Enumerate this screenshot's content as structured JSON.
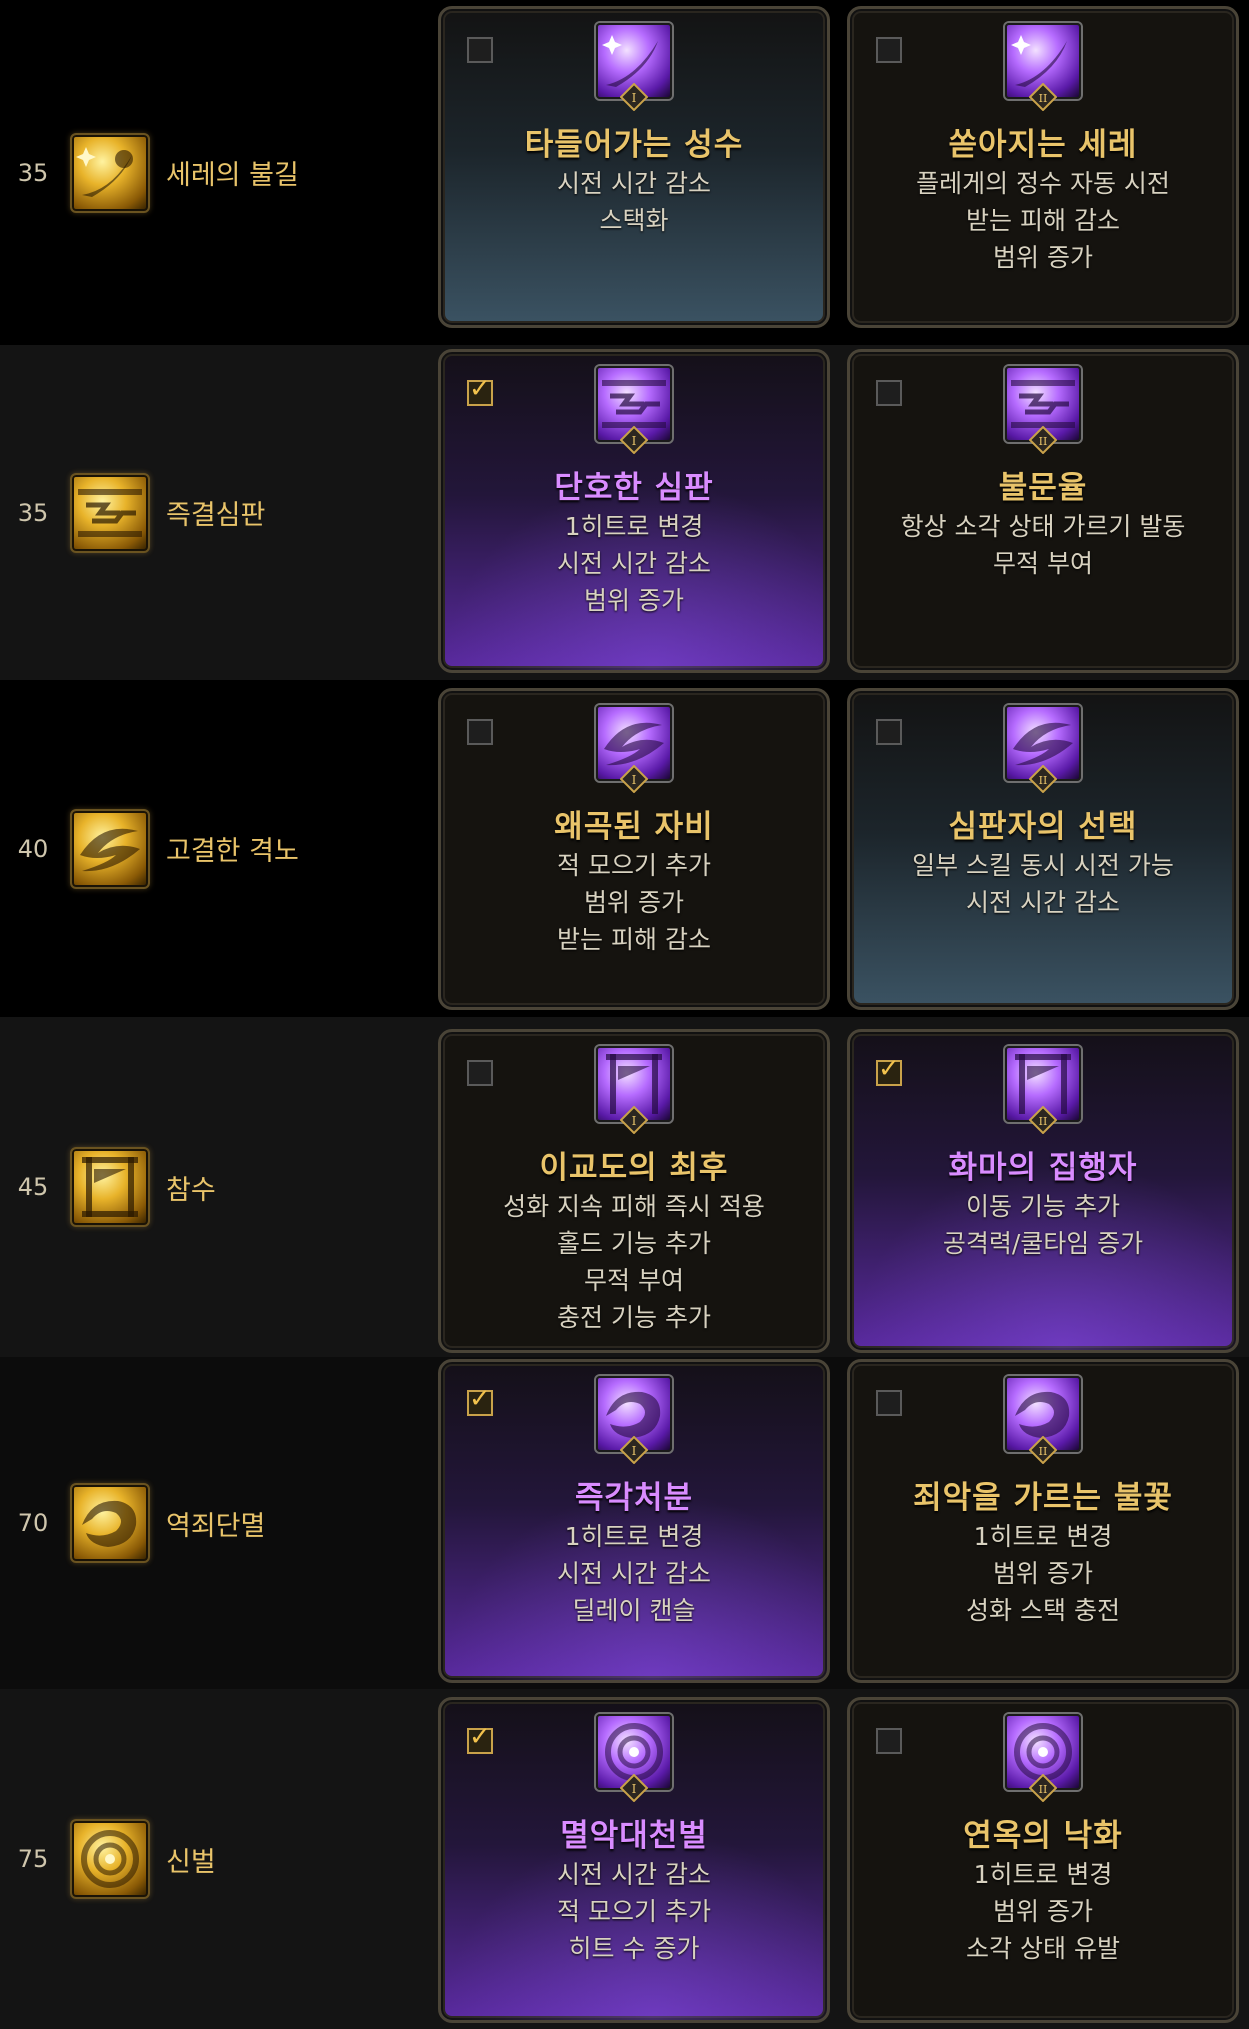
{
  "rows": [
    {
      "level": "35",
      "skill": "세레의 불길",
      "icon": "comet-icon",
      "tripods": [
        {
          "checked": false,
          "icon": "star-comet-icon",
          "tier": "I",
          "name": "타들어가는 성수",
          "desc": [
            "시전 시간 감소",
            "스택화"
          ]
        },
        {
          "checked": false,
          "icon": "star-comet-icon",
          "tier": "II",
          "name": "쏟아지는 세레",
          "desc": [
            "플레게의 정수 자동 시전",
            "받는 피해 감소",
            "범위 증가"
          ]
        }
      ]
    },
    {
      "level": "35",
      "skill": "즉결심판",
      "icon": "swift-judgment-icon",
      "tripods": [
        {
          "checked": true,
          "icon": "swift-judgment-icon",
          "tier": "I",
          "name": "단호한 심판",
          "desc": [
            "1히트로 변경",
            "시전 시간 감소",
            "범위 증가"
          ]
        },
        {
          "checked": false,
          "icon": "swift-judgment-icon",
          "tier": "II",
          "name": "불문율",
          "desc": [
            "항상 소각 상태 가르기 발동",
            "무적 부여"
          ]
        }
      ]
    },
    {
      "level": "40",
      "skill": "고결한 격노",
      "icon": "noble-fury-icon",
      "tripods": [
        {
          "checked": false,
          "icon": "noble-fury-icon",
          "tier": "I",
          "name": "왜곡된 자비",
          "desc": [
            "적 모으기 추가",
            "범위 증가",
            "받는 피해 감소"
          ]
        },
        {
          "checked": false,
          "icon": "noble-fury-icon",
          "tier": "II",
          "name": "심판자의 선택",
          "desc": [
            "일부 스킬 동시 시전 가능",
            "시전 시간 감소"
          ]
        }
      ]
    },
    {
      "level": "45",
      "skill": "참수",
      "icon": "guillotine-icon",
      "tripods": [
        {
          "checked": false,
          "icon": "guillotine-icon",
          "tier": "I",
          "name": "이교도의 최후",
          "desc": [
            "성화 지속 피해 즉시 적용",
            "홀드 기능 추가",
            "무적 부여",
            "충전 기능 추가"
          ]
        },
        {
          "checked": true,
          "icon": "guillotine-icon",
          "tier": "II",
          "name": "화마의 집행자",
          "desc": [
            "이동 기능 추가",
            "공격력/쿨타임 증가"
          ]
        }
      ]
    },
    {
      "level": "70",
      "skill": "역죄단멸",
      "icon": "treason-icon",
      "tripods": [
        {
          "checked": true,
          "icon": "treason-icon",
          "tier": "I",
          "name": "즉각처분",
          "desc": [
            "1히트로 변경",
            "시전 시간 감소",
            "딜레이 캔슬"
          ]
        },
        {
          "checked": false,
          "icon": "treason-icon",
          "tier": "II",
          "name": "죄악을 가르는 불꽃",
          "desc": [
            "1히트로 변경",
            "범위 증가",
            "성화 스택 충전"
          ]
        }
      ]
    },
    {
      "level": "75",
      "skill": "신벌",
      "icon": "divine-punishment-icon",
      "tripods": [
        {
          "checked": true,
          "icon": "divine-punishment-icon",
          "tier": "I",
          "name": "멸악대천벌",
          "desc": [
            "시전 시간 감소",
            "적 모으기 추가",
            "히트 수 증가"
          ]
        },
        {
          "checked": false,
          "icon": "divine-punishment-icon",
          "tier": "II",
          "name": "연옥의 낙화",
          "desc": [
            "1히트로 변경",
            "범위 증가",
            "소각 상태 유발"
          ]
        }
      ]
    }
  ]
}
